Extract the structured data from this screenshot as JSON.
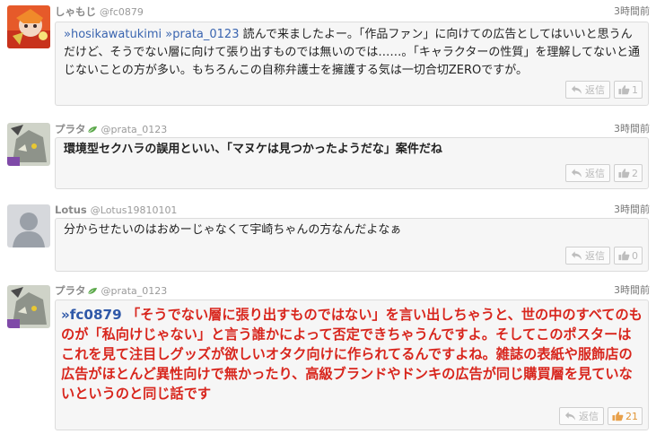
{
  "reply_label": "返信",
  "posts": [
    {
      "username": "しゃもじ",
      "user_id": "@fc0879",
      "time": "3時間前",
      "mentions": [
        "»hosikawatukimi",
        "»prata_0123"
      ],
      "body": "読んで来ましたよー。「作品ファン」に向けての広告としてはいいと思うんだけど、そうでない層に向けて張り出すものでは無いのでは……。「キャラクターの性質」を理解してないと通じないことの方が多い。もちろんこの自称弁護士を擁護する気は一切合切ZEROですが。",
      "likes": "1"
    },
    {
      "username": "プラタ",
      "user_id": "@prata_0123",
      "time": "3時間前",
      "body": "環境型セクハラの誤用といい、「マヌケは見つかったようだな」案件だね",
      "likes": "2"
    },
    {
      "username": "Lotus",
      "user_id": "@Lotus19810101",
      "time": "3時間前",
      "body": "分からせたいのはおめーじゃなくて宇崎ちゃんの方なんだよなぁ",
      "likes": "0"
    },
    {
      "username": "プラタ",
      "user_id": "@prata_0123",
      "time": "3時間前",
      "mention": "»fc0879",
      "body": "「そうでない層に張り出すものではない」を言い出しちゃうと、世の中のすべてのものが「私向けじゃない」と言う誰かによって否定できちゃうんですよ。そしてこのポスターはこれを見て注目しグッズが欲しいオタク向けに作られてるんですよね。雑誌の表紙や服飾店の広告がほとんど異性向けで無かったり、高級ブランドやドンキの広告が同じ購買層を見ていないというのと同じ話です",
      "likes": "21"
    }
  ]
}
